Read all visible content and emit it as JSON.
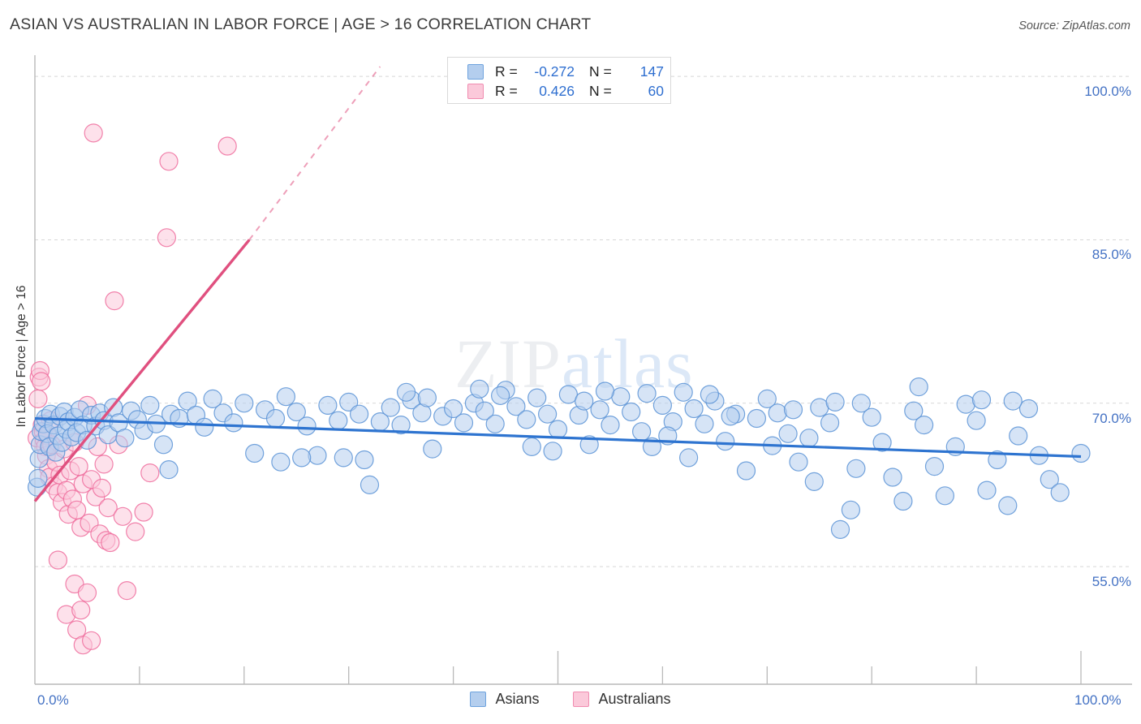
{
  "header": {
    "title": "ASIAN VS AUSTRALIAN IN LABOR FORCE | AGE > 16 CORRELATION CHART",
    "source": "Source: ZipAtlas.com"
  },
  "watermark": {
    "part1": "ZIP",
    "part2": "atlas"
  },
  "stats": {
    "rows": [
      {
        "color": "#b4ceee",
        "r_label": "R =",
        "r_value": "-0.272",
        "n_label": "N =",
        "n_value": "147"
      },
      {
        "color": "#fbc9da",
        "r_label": "R =",
        "r_value": "0.426",
        "n_label": "N =",
        "n_value": "60"
      }
    ]
  },
  "legend": {
    "items": [
      {
        "label": "Asians",
        "color": "#b4ceee"
      },
      {
        "label": "Australians",
        "color": "#fbc9da"
      }
    ]
  },
  "chart_data": {
    "type": "scatter",
    "title": "ASIAN VS AUSTRALIAN IN LABOR FORCE | AGE > 16 CORRELATION CHART",
    "xlabel": "",
    "ylabel": "In Labor Force | Age > 16",
    "xlim": [
      0,
      100
    ],
    "ylim": [
      44.2,
      101.8
    ],
    "grid": true,
    "legend_position": "bottom-center",
    "x_ticks": [
      {
        "value": 0,
        "label": "0.0%"
      },
      {
        "value": 100,
        "label": "100.0%"
      }
    ],
    "y_ticks": [
      {
        "value": 100,
        "label": "100.0%"
      },
      {
        "value": 85,
        "label": "85.0%"
      },
      {
        "value": 70,
        "label": "70.0%"
      },
      {
        "value": 55,
        "label": "55.0%"
      }
    ],
    "series": [
      {
        "name": "Asians",
        "color": "#b4ceee",
        "stroke": "#5b93d6",
        "r": -0.272,
        "n": 147,
        "trendline": {
          "x0": 0,
          "y0": 68.6,
          "x1": 100,
          "y1": 65.1,
          "color": "#2e74d0"
        },
        "points": [
          [
            0.2,
            62.3
          ],
          [
            0.3,
            63.1
          ],
          [
            0.4,
            64.9
          ],
          [
            0.5,
            66.2
          ],
          [
            0.6,
            67.4
          ],
          [
            0.8,
            68.1
          ],
          [
            1.0,
            68.6
          ],
          [
            1.2,
            67.2
          ],
          [
            1.4,
            66.0
          ],
          [
            1.5,
            69.0
          ],
          [
            1.8,
            68.0
          ],
          [
            2.0,
            65.5
          ],
          [
            2.2,
            67.0
          ],
          [
            2.4,
            68.8
          ],
          [
            2.6,
            66.4
          ],
          [
            2.8,
            69.2
          ],
          [
            3.0,
            67.6
          ],
          [
            3.2,
            68.3
          ],
          [
            3.5,
            66.9
          ],
          [
            3.8,
            68.7
          ],
          [
            4.0,
            67.3
          ],
          [
            4.3,
            69.4
          ],
          [
            4.6,
            68.0
          ],
          [
            5.0,
            66.6
          ],
          [
            5.4,
            68.9
          ],
          [
            5.8,
            67.9
          ],
          [
            6.2,
            69.1
          ],
          [
            6.6,
            68.4
          ],
          [
            7.0,
            67.1
          ],
          [
            7.5,
            69.6
          ],
          [
            8.0,
            68.2
          ],
          [
            8.6,
            66.8
          ],
          [
            9.2,
            69.3
          ],
          [
            9.8,
            68.5
          ],
          [
            10.4,
            67.5
          ],
          [
            11.0,
            69.8
          ],
          [
            11.6,
            68.1
          ],
          [
            12.3,
            66.2
          ],
          [
            13.0,
            69.0
          ],
          [
            13.8,
            68.6
          ],
          [
            14.6,
            70.2
          ],
          [
            15.4,
            68.9
          ],
          [
            16.2,
            67.8
          ],
          [
            17.0,
            70.4
          ],
          [
            18.0,
            69.1
          ],
          [
            19.0,
            68.2
          ],
          [
            20.0,
            70.0
          ],
          [
            21.0,
            65.4
          ],
          [
            22.0,
            69.4
          ],
          [
            23.0,
            68.6
          ],
          [
            24.0,
            70.6
          ],
          [
            25.0,
            69.2
          ],
          [
            26.0,
            67.9
          ],
          [
            27.0,
            65.2
          ],
          [
            28.0,
            69.8
          ],
          [
            29.0,
            68.4
          ],
          [
            30.0,
            70.1
          ],
          [
            31.0,
            69.0
          ],
          [
            32.0,
            62.5
          ],
          [
            33.0,
            68.3
          ],
          [
            34.0,
            69.6
          ],
          [
            35.0,
            68.0
          ],
          [
            36.0,
            70.3
          ],
          [
            37.0,
            69.1
          ],
          [
            38.0,
            65.8
          ],
          [
            39.0,
            68.8
          ],
          [
            40.0,
            69.5
          ],
          [
            41.0,
            68.2
          ],
          [
            42.0,
            70.0
          ],
          [
            43.0,
            69.3
          ],
          [
            44.0,
            68.1
          ],
          [
            45.0,
            71.2
          ],
          [
            46.0,
            69.7
          ],
          [
            47.0,
            68.5
          ],
          [
            48.0,
            70.5
          ],
          [
            49.0,
            69.0
          ],
          [
            50.0,
            67.6
          ],
          [
            51.0,
            70.8
          ],
          [
            52.0,
            68.9
          ],
          [
            53.0,
            66.2
          ],
          [
            54.0,
            69.4
          ],
          [
            55.0,
            68.0
          ],
          [
            56.0,
            70.6
          ],
          [
            57.0,
            69.2
          ],
          [
            58.0,
            67.4
          ],
          [
            59.0,
            66.0
          ],
          [
            60.0,
            69.8
          ],
          [
            61.0,
            68.3
          ],
          [
            62.0,
            71.0
          ],
          [
            63.0,
            69.5
          ],
          [
            64.0,
            68.1
          ],
          [
            65.0,
            70.2
          ],
          [
            66.0,
            66.5
          ],
          [
            67.0,
            69.0
          ],
          [
            68.0,
            63.8
          ],
          [
            69.0,
            68.6
          ],
          [
            70.0,
            70.4
          ],
          [
            71.0,
            69.1
          ],
          [
            72.0,
            67.2
          ],
          [
            73.0,
            64.6
          ],
          [
            74.0,
            66.8
          ],
          [
            75.0,
            69.6
          ],
          [
            76.0,
            68.2
          ],
          [
            77.0,
            58.4
          ],
          [
            78.0,
            60.2
          ],
          [
            79.0,
            70.0
          ],
          [
            80.0,
            68.7
          ],
          [
            81.0,
            66.4
          ],
          [
            82.0,
            63.2
          ],
          [
            83.0,
            61.0
          ],
          [
            84.0,
            69.3
          ],
          [
            85.0,
            68.0
          ],
          [
            86.0,
            64.2
          ],
          [
            87.0,
            61.5
          ],
          [
            88.0,
            66.0
          ],
          [
            89.0,
            69.9
          ],
          [
            90.0,
            68.4
          ],
          [
            91.0,
            62.0
          ],
          [
            92.0,
            64.8
          ],
          [
            93.0,
            60.6
          ],
          [
            94.0,
            67.0
          ],
          [
            95.0,
            69.5
          ],
          [
            96.0,
            65.2
          ],
          [
            97.0,
            63.0
          ],
          [
            98.0,
            61.8
          ],
          [
            58.5,
            70.9
          ],
          [
            60.5,
            67.0
          ],
          [
            62.5,
            65.0
          ],
          [
            64.5,
            70.8
          ],
          [
            66.5,
            68.8
          ],
          [
            70.5,
            66.1
          ],
          [
            72.5,
            69.4
          ],
          [
            74.5,
            62.8
          ],
          [
            76.5,
            70.1
          ],
          [
            78.5,
            64.0
          ],
          [
            35.5,
            71.0
          ],
          [
            37.5,
            70.5
          ],
          [
            42.5,
            71.3
          ],
          [
            44.5,
            70.7
          ],
          [
            47.5,
            66.0
          ],
          [
            49.5,
            65.6
          ],
          [
            52.5,
            70.2
          ],
          [
            54.5,
            71.1
          ],
          [
            84.5,
            71.5
          ],
          [
            90.5,
            70.3
          ],
          [
            93.5,
            70.2
          ],
          [
            29.5,
            65.0
          ],
          [
            31.5,
            64.8
          ],
          [
            23.5,
            64.6
          ],
          [
            25.5,
            65.0
          ],
          [
            100.0,
            65.4
          ],
          [
            12.8,
            63.9
          ]
        ]
      },
      {
        "name": "Australians",
        "color": "#fbc9da",
        "stroke": "#ee6c9c",
        "r": 0.426,
        "n": 60,
        "trendline": {
          "x0": 0,
          "y0": 61.0,
          "x1": 20.5,
          "y1": 85.0,
          "color": "#e0507f"
        },
        "trendline_dashed": {
          "x0": 20.5,
          "y0": 85.0,
          "x1": 33.0,
          "y1": 100.9
        },
        "points": [
          [
            0.2,
            66.8
          ],
          [
            0.3,
            70.4
          ],
          [
            0.4,
            72.4
          ],
          [
            0.5,
            73.0
          ],
          [
            0.6,
            72.0
          ],
          [
            0.7,
            68.0
          ],
          [
            0.8,
            67.4
          ],
          [
            0.9,
            66.6
          ],
          [
            1.0,
            66.0
          ],
          [
            1.1,
            65.2
          ],
          [
            1.2,
            67.0
          ],
          [
            1.3,
            64.0
          ],
          [
            1.4,
            63.2
          ],
          [
            1.5,
            68.4
          ],
          [
            1.6,
            66.2
          ],
          [
            1.8,
            62.4
          ],
          [
            2.0,
            64.6
          ],
          [
            2.2,
            61.8
          ],
          [
            2.4,
            63.4
          ],
          [
            2.6,
            60.9
          ],
          [
            2.8,
            65.8
          ],
          [
            3.0,
            62.0
          ],
          [
            3.2,
            59.8
          ],
          [
            3.4,
            63.8
          ],
          [
            3.6,
            61.2
          ],
          [
            3.8,
            66.4
          ],
          [
            4.0,
            60.2
          ],
          [
            4.2,
            64.2
          ],
          [
            4.4,
            58.6
          ],
          [
            4.6,
            62.6
          ],
          [
            5.0,
            69.8
          ],
          [
            5.2,
            59.0
          ],
          [
            5.4,
            63.0
          ],
          [
            5.8,
            61.4
          ],
          [
            6.0,
            66.0
          ],
          [
            6.2,
            58.0
          ],
          [
            6.4,
            62.2
          ],
          [
            6.6,
            64.4
          ],
          [
            6.8,
            57.4
          ],
          [
            7.0,
            60.4
          ],
          [
            7.2,
            57.2
          ],
          [
            7.6,
            79.4
          ],
          [
            8.0,
            66.2
          ],
          [
            8.4,
            59.6
          ],
          [
            8.8,
            52.8
          ],
          [
            5.6,
            94.8
          ],
          [
            12.8,
            92.2
          ],
          [
            18.4,
            93.6
          ],
          [
            12.6,
            85.2
          ],
          [
            2.2,
            55.6
          ],
          [
            3.0,
            50.6
          ],
          [
            4.0,
            49.2
          ],
          [
            4.4,
            51.0
          ],
          [
            4.6,
            47.8
          ],
          [
            5.4,
            48.2
          ],
          [
            3.8,
            53.4
          ],
          [
            5.0,
            52.6
          ],
          [
            9.6,
            58.2
          ],
          [
            10.4,
            60.0
          ],
          [
            11.0,
            63.6
          ]
        ]
      }
    ]
  }
}
